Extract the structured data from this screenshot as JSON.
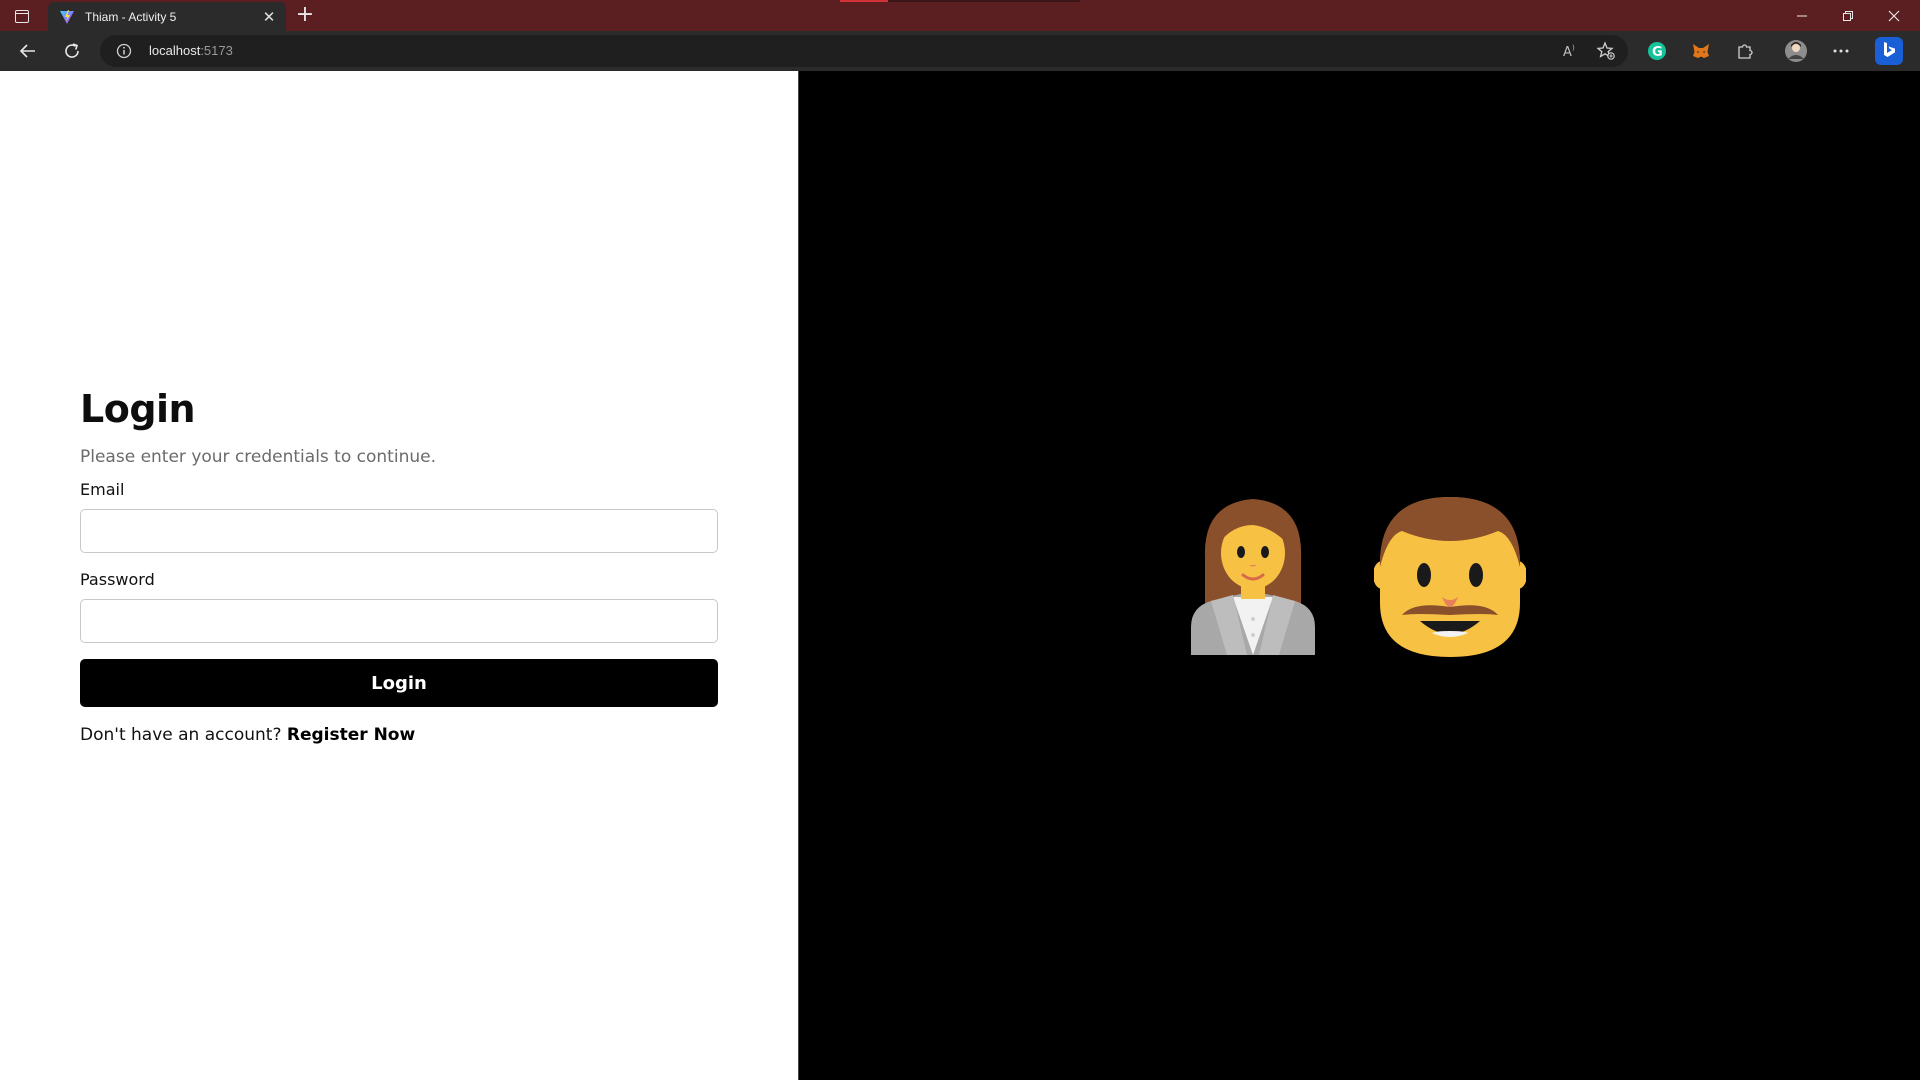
{
  "browser": {
    "tab_title": "Thiam - Activity 5",
    "url_host": "localhost",
    "url_port": ":5173"
  },
  "login": {
    "heading": "Login",
    "subtitle": "Please enter your credentials to continue.",
    "email_label": "Email",
    "email_value": "",
    "password_label": "Password",
    "password_value": "",
    "login_button": "Login",
    "register_prompt": "Don't have an account?",
    "register_link": "Register Now"
  },
  "illustration": {
    "icons": [
      "woman-office-worker-icon",
      "man-face-icon"
    ]
  },
  "colors": {
    "titlebar": "#5b1f22",
    "toolbar": "#2b2b2b",
    "button": "#000000",
    "illustration_bg": "#000000",
    "skin": "#f7c143",
    "hair": "#8a4f2b"
  }
}
